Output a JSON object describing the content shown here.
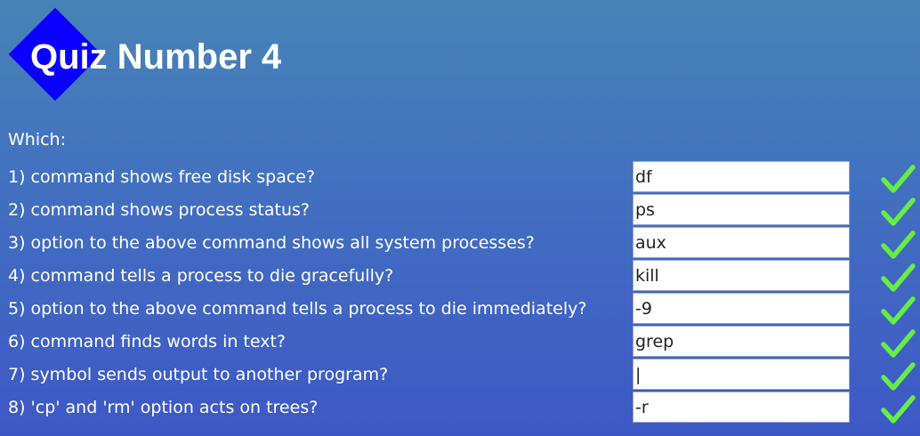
{
  "quiz": {
    "title": "Quiz Number 4",
    "intro": "Which:",
    "check_color": "#66ee44",
    "logo_color": "#0b00ff",
    "questions": [
      {
        "text": "1) command shows free disk space?",
        "answer": "df",
        "status": "correct",
        "icon": "check-icon"
      },
      {
        "text": "2) command shows process status?",
        "answer": "ps",
        "status": "correct",
        "icon": "check-icon"
      },
      {
        "text": "3) option to the above command shows all system processes?",
        "answer": "aux",
        "status": "correct",
        "icon": "check-icon"
      },
      {
        "text": "4) command tells a process to die gracefully?",
        "answer": "kill",
        "status": "correct",
        "icon": "check-icon"
      },
      {
        "text": "5) option to the above command tells a process to die immediately?",
        "answer": "-9",
        "status": "correct",
        "icon": "check-icon"
      },
      {
        "text": "6) command finds words in text?",
        "answer": "grep",
        "status": "correct",
        "icon": "check-icon"
      },
      {
        "text": "7) symbol sends output to another program?",
        "answer": "|",
        "status": "correct",
        "icon": "check-icon"
      },
      {
        "text": "8) 'cp' and 'rm' option acts on trees?",
        "answer": "-r",
        "status": "correct",
        "icon": "check-icon"
      }
    ]
  }
}
